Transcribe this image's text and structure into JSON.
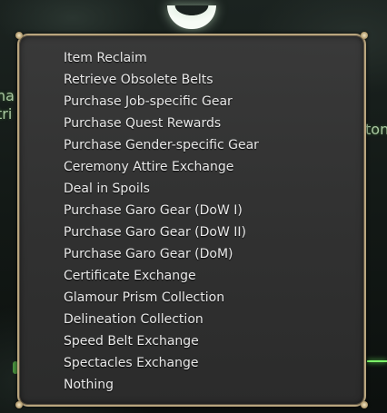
{
  "background": {
    "left_fragment_1": "na",
    "left_fragment_2": "tri",
    "right_fragment": "ton"
  },
  "menu": {
    "items": [
      {
        "label": "Item Reclaim"
      },
      {
        "label": "Retrieve Obsolete Belts"
      },
      {
        "label": "Purchase Job-specific Gear"
      },
      {
        "label": "Purchase Quest Rewards"
      },
      {
        "label": "Purchase Gender-specific Gear"
      },
      {
        "label": "Ceremony Attire Exchange"
      },
      {
        "label": "Deal in Spoils"
      },
      {
        "label": "Purchase Garo Gear (DoW I)"
      },
      {
        "label": "Purchase Garo Gear (DoW II)"
      },
      {
        "label": "Purchase Garo Gear (DoM)"
      },
      {
        "label": "Certificate Exchange"
      },
      {
        "label": "Glamour Prism Collection"
      },
      {
        "label": "Delineation Collection"
      },
      {
        "label": "Speed Belt Exchange"
      },
      {
        "label": "Spectacles Exchange"
      },
      {
        "label": "Nothing"
      }
    ]
  },
  "colors": {
    "frame_border": "#b9a57e",
    "menu_background": "#3a3a3a",
    "menu_text": "#e9e9e9",
    "background_text": "#a9c7a0",
    "highlight_green": "#7dff6a"
  }
}
